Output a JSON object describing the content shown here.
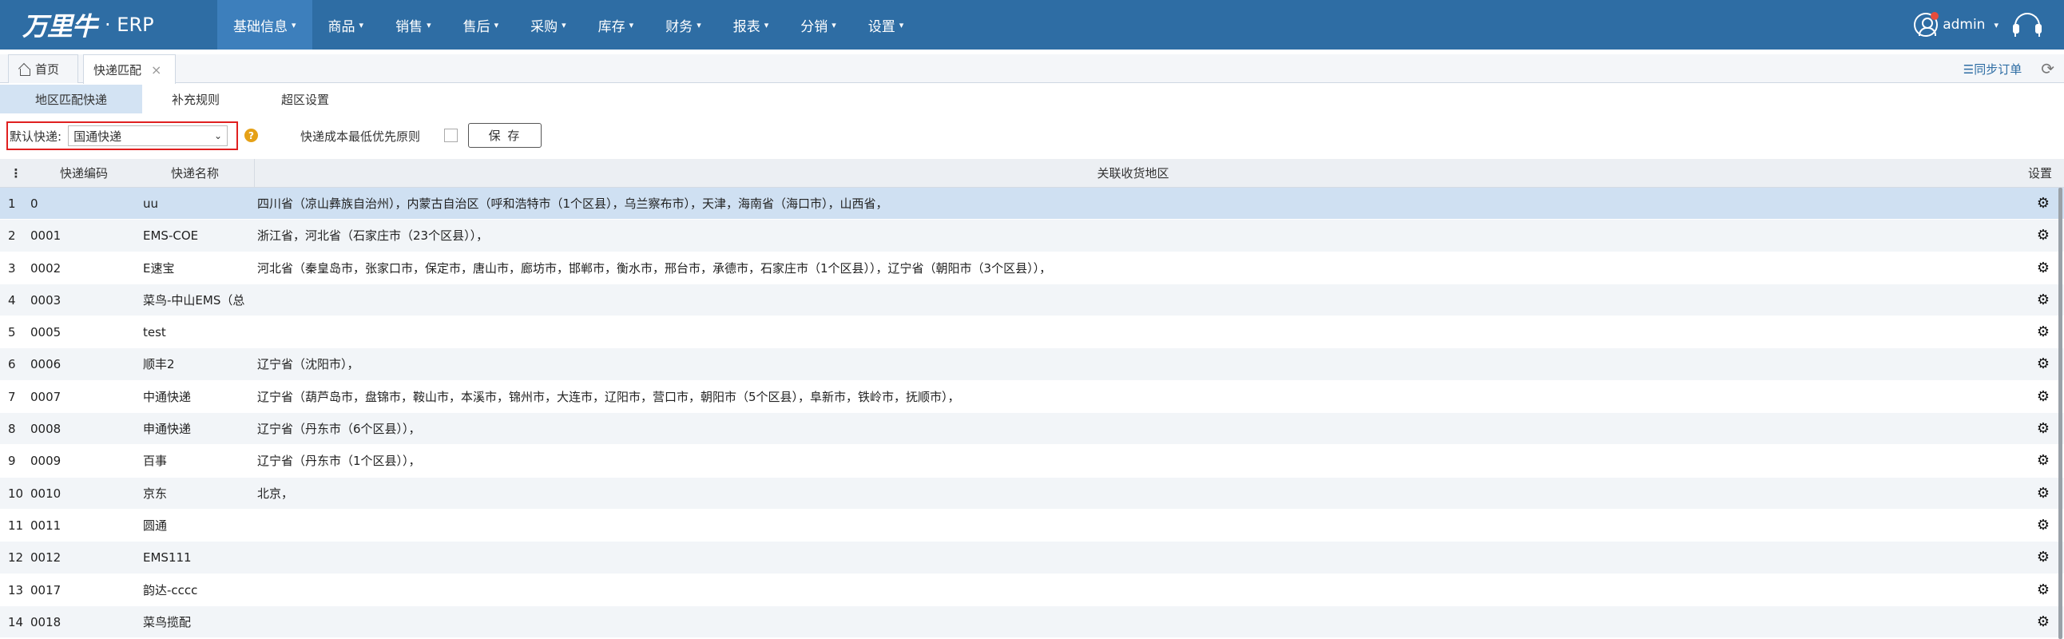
{
  "header": {
    "logo_text": "万里牛",
    "logo_suffix": "· ERP",
    "nav": [
      {
        "label": "基础信息",
        "active": true
      },
      {
        "label": "商品"
      },
      {
        "label": "销售"
      },
      {
        "label": "售后"
      },
      {
        "label": "采购"
      },
      {
        "label": "库存"
      },
      {
        "label": "财务"
      },
      {
        "label": "报表"
      },
      {
        "label": "分销"
      },
      {
        "label": "设置"
      }
    ],
    "user": "admin",
    "accent": "#2e6da4"
  },
  "tabs": {
    "home": "首页",
    "current": "快递匹配",
    "close": "×",
    "sync_orders": "☰同步订单"
  },
  "subtabs": [
    "地区匹配快递",
    "补充规则",
    "超区设置"
  ],
  "toolbar": {
    "default_label": "默认快递:",
    "default_value": "国通快递",
    "help": "?",
    "cost_label": "快递成本最低优先原则",
    "cost_checked": false,
    "save_label": "保 存"
  },
  "grid": {
    "columns": {
      "code": "快递编码",
      "name": "快递名称",
      "region": "关联收货地区",
      "settings": "设置"
    },
    "rows": [
      {
        "idx": "1",
        "code": "0",
        "name": "uu",
        "region": "四川省（凉山彝族自治州），内蒙古自治区（呼和浩特市（1个区县），乌兰察布市），天津，海南省（海口市），山西省，"
      },
      {
        "idx": "2",
        "code": "0001",
        "name": "EMS-COE",
        "region": "浙江省，河北省（石家庄市（23个区县）），"
      },
      {
        "idx": "3",
        "code": "0002",
        "name": "E速宝",
        "region": "河北省（秦皇岛市，张家口市，保定市，唐山市，廊坊市，邯郸市，衡水市，邢台市，承德市，石家庄市（1个区县）），辽宁省（朝阳市（3个区县）），"
      },
      {
        "idx": "4",
        "code": "0003",
        "name": "菜鸟-中山EMS（总",
        "region": ""
      },
      {
        "idx": "5",
        "code": "0005",
        "name": "test",
        "region": ""
      },
      {
        "idx": "6",
        "code": "0006",
        "name": "顺丰2",
        "region": "辽宁省（沈阳市），"
      },
      {
        "idx": "7",
        "code": "0007",
        "name": "中通快递",
        "region": "辽宁省（葫芦岛市，盘锦市，鞍山市，本溪市，锦州市，大连市，辽阳市，营口市，朝阳市（5个区县），阜新市，铁岭市，抚顺市），"
      },
      {
        "idx": "8",
        "code": "0008",
        "name": "申通快递",
        "region": "辽宁省（丹东市（6个区县）），"
      },
      {
        "idx": "9",
        "code": "0009",
        "name": "百事",
        "region": "辽宁省（丹东市（1个区县）），"
      },
      {
        "idx": "10",
        "code": "0010",
        "name": "京东",
        "region": "北京，"
      },
      {
        "idx": "11",
        "code": "0011",
        "name": "圆通",
        "region": ""
      },
      {
        "idx": "12",
        "code": "0012",
        "name": "EMS111",
        "region": ""
      },
      {
        "idx": "13",
        "code": "0017",
        "name": "韵达-cccc",
        "region": ""
      },
      {
        "idx": "14",
        "code": "0018",
        "name": "菜鸟揽配",
        "region": ""
      }
    ]
  }
}
